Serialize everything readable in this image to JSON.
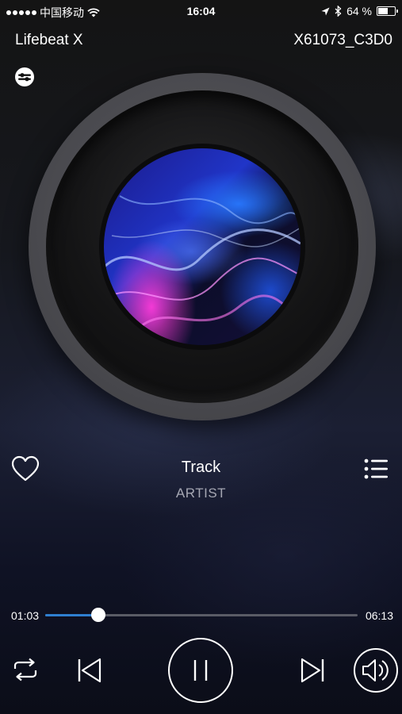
{
  "status_bar": {
    "carrier": "中国移动",
    "time": "16:04",
    "battery_text": "64 %",
    "battery_level": 0.64,
    "icons": [
      "signal-dots-icon",
      "wifi-icon",
      "location-icon",
      "bluetooth-icon",
      "battery-icon"
    ]
  },
  "header": {
    "app_name": "Lifebeat X",
    "device_id": "X61073_C3D0",
    "source_icon": "source-toggle-icon"
  },
  "player": {
    "artwork": "album-art-disc",
    "track_title": "Track",
    "artist": "ARTIST",
    "favorite_icon": "heart-icon",
    "playlist_icon": "list-icon"
  },
  "progress": {
    "elapsed": "01:03",
    "total": "06:13",
    "fraction": 0.171
  },
  "controls": {
    "repeat_icon": "repeat-icon",
    "previous_icon": "previous-icon",
    "play_pause_icon": "pause-icon",
    "next_icon": "next-icon",
    "volume_icon": "volume-icon"
  },
  "colors": {
    "accent": "#2f7fd0",
    "text_primary": "#ffffff",
    "text_secondary": "#a5a7b3"
  }
}
